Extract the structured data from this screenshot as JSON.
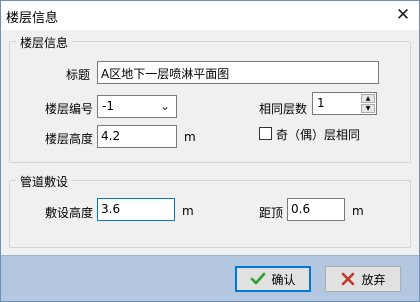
{
  "window": {
    "title": "楼层信息",
    "close_glyph": "✕"
  },
  "floor_group": {
    "title": "楼层信息",
    "name_label": "标题",
    "name_value": "A区地下一层喷淋平面图",
    "floor_no_label": "楼层编号",
    "floor_no_value": "-1",
    "floor_height_label": "楼层高度",
    "floor_height_value": "4.2",
    "floor_height_unit": "m",
    "same_floors_label": "相同层数",
    "same_floors_value": "1",
    "odd_even_label": "奇（偶）层相同",
    "odd_even_checked": false
  },
  "pipe_group": {
    "title": "管道敷设",
    "lay_height_label": "敷设高度",
    "lay_height_value": "3.6",
    "lay_height_unit": "m",
    "top_dist_label": "距顶",
    "top_dist_value": "0.6",
    "top_dist_unit": "m"
  },
  "footer": {
    "ok_label": "确认",
    "ok_icon": "check-icon",
    "cancel_label": "放弃",
    "cancel_icon": "x-icon",
    "ok_color": "#2e9e2e",
    "cancel_color": "#c0392b"
  }
}
